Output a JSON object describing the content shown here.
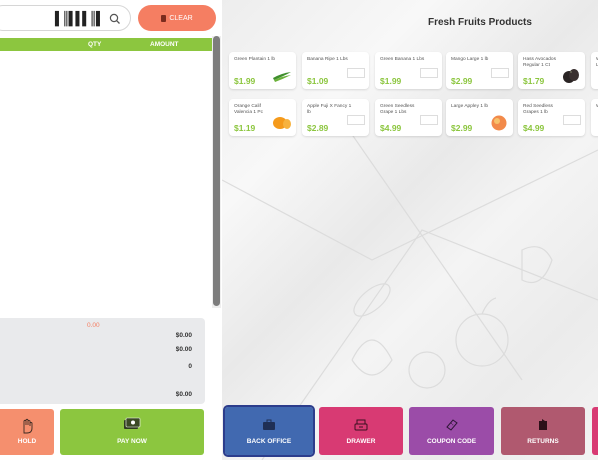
{
  "search": {
    "barcode_glyph": "▌║▌▌▌║▌",
    "icon": "search-icon"
  },
  "clear_button": {
    "label": "CLEAR",
    "icon": "trash-icon"
  },
  "order_table": {
    "columns": [
      "QTY",
      "AMOUNT"
    ]
  },
  "totals": {
    "discount": "0.00",
    "line1": "$0.00",
    "line2": "$0.00",
    "line3": "0",
    "line4": "$0.00"
  },
  "actions": {
    "hold": "HOLD",
    "pay_now": "PAY NOW"
  },
  "category": {
    "title": "Fresh Fruits Products"
  },
  "products": [
    {
      "name": "Green Plantain 1 lb",
      "price": "$1.99",
      "image": "plantain"
    },
    {
      "name": "Banana Ripe 1 Lbs",
      "price": "$1.09",
      "image": "none"
    },
    {
      "name": "Green Banana 1 Lbs",
      "price": "$1.99",
      "image": "none"
    },
    {
      "name": "Mango Large 1 lb",
      "price": "$2.99",
      "image": "none"
    },
    {
      "name": "Hass Avocados Regular 1 Ct",
      "price": "$1.79",
      "image": "avocado"
    },
    {
      "name": "Orange Calif Valencia 1 Pc",
      "price": "$1.19",
      "image": "orange"
    },
    {
      "name": "Apple Fuji X Fancy 1 lb",
      "price": "$2.89",
      "image": "none"
    },
    {
      "name": "Green Seedless Grape 1 Lbs",
      "price": "$4.99",
      "image": "none"
    },
    {
      "name": "Large Appley 1 lb",
      "price": "$2.99",
      "image": "peach"
    },
    {
      "name": "Red Seedless Grapes 1 lb",
      "price": "$4.99",
      "image": "none"
    }
  ],
  "bottom_buttons": {
    "back_office": "BACK OFFICE",
    "drawer": "DRAWER",
    "coupon_code": "COUPON CODE",
    "returns": "RETURNS"
  },
  "colors": {
    "accent_green": "#8cc63f",
    "clear_orange": "#f57e62",
    "back_office_blue": "#4169b0",
    "drawer_pink": "#d83a73",
    "coupon_purple": "#9b4ca8",
    "returns_mauve": "#b0596f"
  }
}
